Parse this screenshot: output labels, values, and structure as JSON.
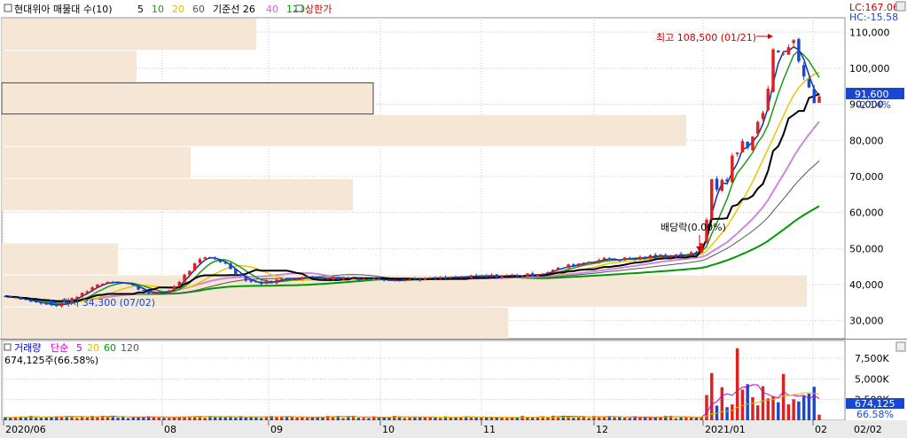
{
  "header": {
    "title": "현대위아 매물대 수(10)",
    "ma_labels": [
      {
        "text": "5",
        "color": "#000000"
      },
      {
        "text": "10",
        "color": "#1a9a1a"
      },
      {
        "text": "20",
        "color": "#d8c000"
      },
      {
        "text": "60",
        "color": "#555555"
      },
      {
        "text": "기준선 26",
        "color": "#000000"
      },
      {
        "text": "40",
        "color": "#cc66cc"
      },
      {
        "text": "120",
        "color": "#009900"
      }
    ],
    "limit_label": "상한가",
    "limit_color": "#cc0000",
    "lc": "LC:167.06",
    "hc": "HC:-15.58"
  },
  "price_panel": {
    "y_ticks": [
      "110,000",
      "100,000",
      "90,000",
      "80,000",
      "70,000",
      "60,000",
      "50,000",
      "40,000",
      "30,000"
    ],
    "current_price": "91,600",
    "change": "-2.14%",
    "high_annotation": "최고 108,500 (01/21)",
    "low_annotation": "최저 34,300 (07/02)",
    "dividend_annotation": "배당락(0.00%)"
  },
  "volume_panel": {
    "legend": [
      {
        "text": "거래량",
        "color": "#0000cc"
      },
      {
        "text": "단순",
        "color": "#cc00cc"
      },
      {
        "text": "5",
        "color": "#cc00cc"
      },
      {
        "text": "20",
        "color": "#d8c000"
      },
      {
        "text": "60",
        "color": "#009900"
      },
      {
        "text": "120",
        "color": "#555555"
      }
    ],
    "info": "674,125주(66.58%)",
    "y_ticks": [
      "7,500K",
      "5,000K",
      "2,500K"
    ],
    "current_volume": "674,125",
    "volume_pct": "66.58%"
  },
  "x_axis": {
    "labels": [
      "2020/06",
      "08",
      "09",
      "10",
      "11",
      "12",
      "2021/01",
      "02"
    ],
    "right_label": "02/02"
  },
  "colors": {
    "up": "#e02020",
    "down": "#1848d0",
    "profile": "#f5e6d6",
    "profile_border": "#b89a80",
    "grid": "#c8c8c8"
  },
  "chart_data": {
    "type": "candlestick",
    "y_unit": "KRW",
    "ylim": [
      25000,
      114000
    ],
    "volume_ylim": [
      0,
      9000000
    ],
    "x_range": [
      "2020/06",
      "2021/02/02"
    ],
    "price_keypoints": [
      {
        "date": "2020/06",
        "close": 36800
      },
      {
        "date": "2020/07/02",
        "close": 34300
      },
      {
        "date": "2020/07 mid",
        "close": 41000
      },
      {
        "date": "2020/07 end",
        "close": 37500
      },
      {
        "date": "2020/08 mid",
        "close": 47500
      },
      {
        "date": "2020/08 end",
        "close": 40500
      },
      {
        "date": "2020/09",
        "close": 42000
      },
      {
        "date": "2020/10",
        "close": 41500
      },
      {
        "date": "2020/11",
        "close": 42500
      },
      {
        "date": "2020/12",
        "close": 47000
      },
      {
        "date": "2020/12 end",
        "close": 48500
      },
      {
        "date": "2021/01 start",
        "close": 67000
      },
      {
        "date": "2021/01 mid",
        "close": 82000
      },
      {
        "date": "2021/01/21",
        "close": 108500
      },
      {
        "date": "2021/02/02",
        "close": 91600
      }
    ],
    "high": {
      "value": 108500,
      "date": "01/21"
    },
    "low": {
      "value": 34300,
      "date": "07/02"
    },
    "moving_averages": [
      {
        "name": "5",
        "end_value": 95000
      },
      {
        "name": "10",
        "end_value": 97500
      },
      {
        "name": "20",
        "end_value": 88500
      },
      {
        "name": "기준선 26",
        "end_value": 77500
      },
      {
        "name": "40",
        "end_value": 69500
      },
      {
        "name": "60",
        "end_value": 62000
      },
      {
        "name": "120",
        "end_value": 52000
      }
    ],
    "volume_profile_bins": 10,
    "volume_spikes": [
      {
        "date": "2021/01 start",
        "volume": 5700000
      },
      {
        "date": "2021/01 mid",
        "volume": 8700000
      },
      {
        "date": "2021/01/21",
        "volume": 5600000
      },
      {
        "date": "2021/02/02",
        "volume": 674125
      }
    ]
  }
}
